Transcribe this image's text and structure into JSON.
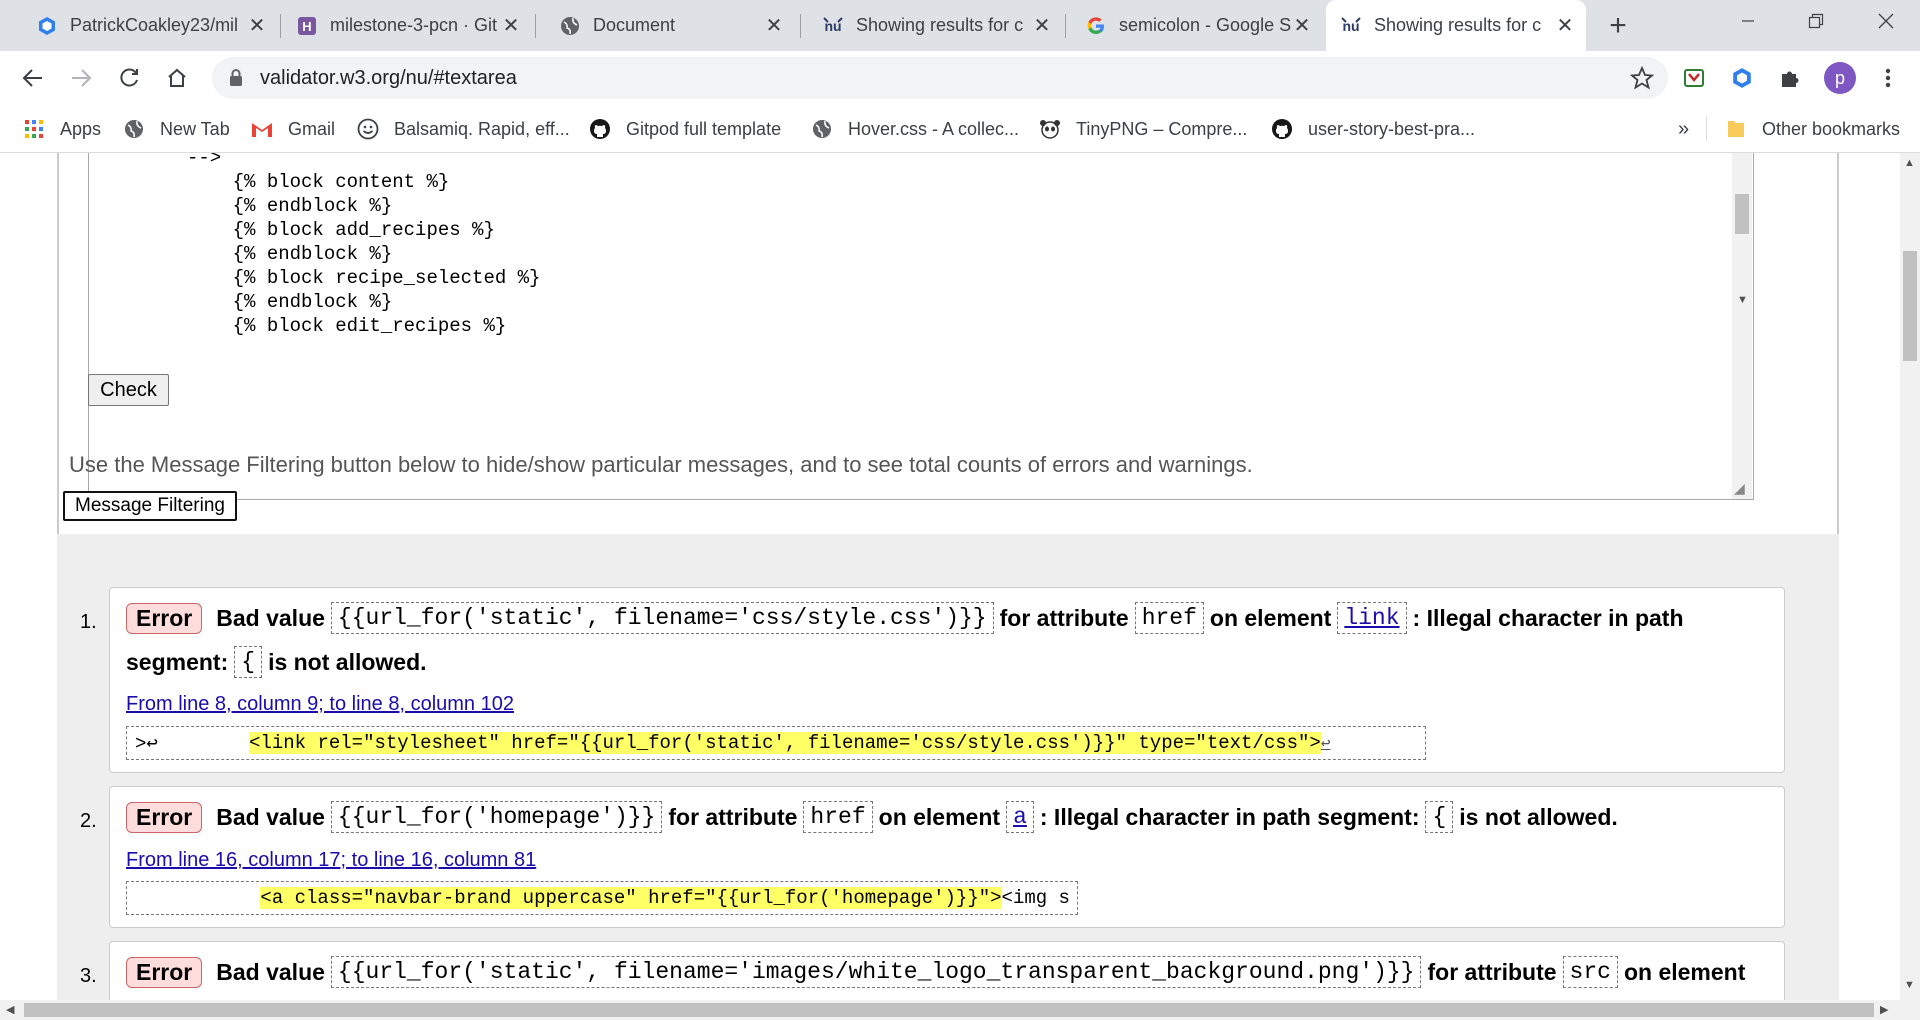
{
  "tabs": [
    {
      "title": "PatrickCoakley23/mil",
      "icon": "cube-icon"
    },
    {
      "title": "milestone-3-pcn · Git",
      "icon": "heroku-icon"
    },
    {
      "title": "Document",
      "icon": "globe-icon"
    },
    {
      "title": "Showing results for c",
      "icon": "nu-validator-icon"
    },
    {
      "title": "semicolon - Google S",
      "icon": "google-icon"
    },
    {
      "title": "Showing results for c",
      "icon": "nu-validator-icon"
    }
  ],
  "address_bar": {
    "url": "validator.w3.org/nu/#textarea"
  },
  "profile": {
    "initial": "p"
  },
  "bookmarks": [
    {
      "label": "Apps",
      "icon": "apps-grid-icon"
    },
    {
      "label": "New Tab",
      "icon": "globe-icon"
    },
    {
      "label": "Gmail",
      "icon": "gmail-icon"
    },
    {
      "label": "Balsamiq. Rapid, eff...",
      "icon": "smile-icon"
    },
    {
      "label": "Gitpod full template",
      "icon": "github-icon"
    },
    {
      "label": "Hover.css - A collec...",
      "icon": "globe-icon"
    },
    {
      "label": "TinyPNG – Compre...",
      "icon": "panda-icon"
    },
    {
      "label": "user-story-best-pra...",
      "icon": "github-icon"
    }
  ],
  "bookmarks_overflow": "»",
  "other_bookmarks": "Other bookmarks",
  "textarea": {
    "content": "-->\n    {% block content %}\n    {% endblock %}\n    {% block add_recipes %}\n    {% endblock %}\n    {% block recipe_selected %}\n    {% endblock %}\n    {% block edit_recipes %}"
  },
  "check_button": "Check",
  "filter_text": "Use the Message Filtering button below to hide/show particular messages, and to see total counts of errors and warnings.",
  "filter_button": "Message Filtering",
  "messages": [
    {
      "num": "1.",
      "badge": "Error",
      "line1": {
        "t1": "Bad value",
        "value": "{{url_for('static', filename='css/style.css')}}",
        "t2": "for attribute",
        "attr": "href",
        "t3": "on element",
        "element": "link",
        "t4": ": Illegal character in path"
      },
      "line2": {
        "t1": "segment:",
        "char": "{",
        "t2": "is not allowed."
      },
      "location": "From line 8, column 9; to line 8, column 102",
      "extract_pre": ">↩        ",
      "extract_hl": "<link rel=\"stylesheet\" href=\"{{url_for('static', filename='css/style.css')}}\" type=\"text/css\">",
      "extract_post": "↩"
    },
    {
      "num": "2.",
      "badge": "Error",
      "line1": {
        "t1": "Bad value",
        "value": "{{url_for('homepage')}}",
        "t2": "for attribute",
        "attr": "href",
        "t3": "on element",
        "element": "a",
        "t4": ": Illegal character in path segment:",
        "char": "{",
        "t5": "is not allowed."
      },
      "location": "From line 16, column 17; to line 16, column 81",
      "extract_pre": "           ",
      "extract_hl": "<a class=\"navbar-brand uppercase\" href=\"{{url_for('homepage')}}\">",
      "extract_post": "<img s"
    },
    {
      "num": "3.",
      "badge": "Error",
      "line1": {
        "t1": "Bad value",
        "value": "{{url_for('static', filename='images/white_logo_transparent_background.png')}}",
        "t2": "for attribute",
        "attr": "src",
        "t3": "on element"
      }
    }
  ]
}
